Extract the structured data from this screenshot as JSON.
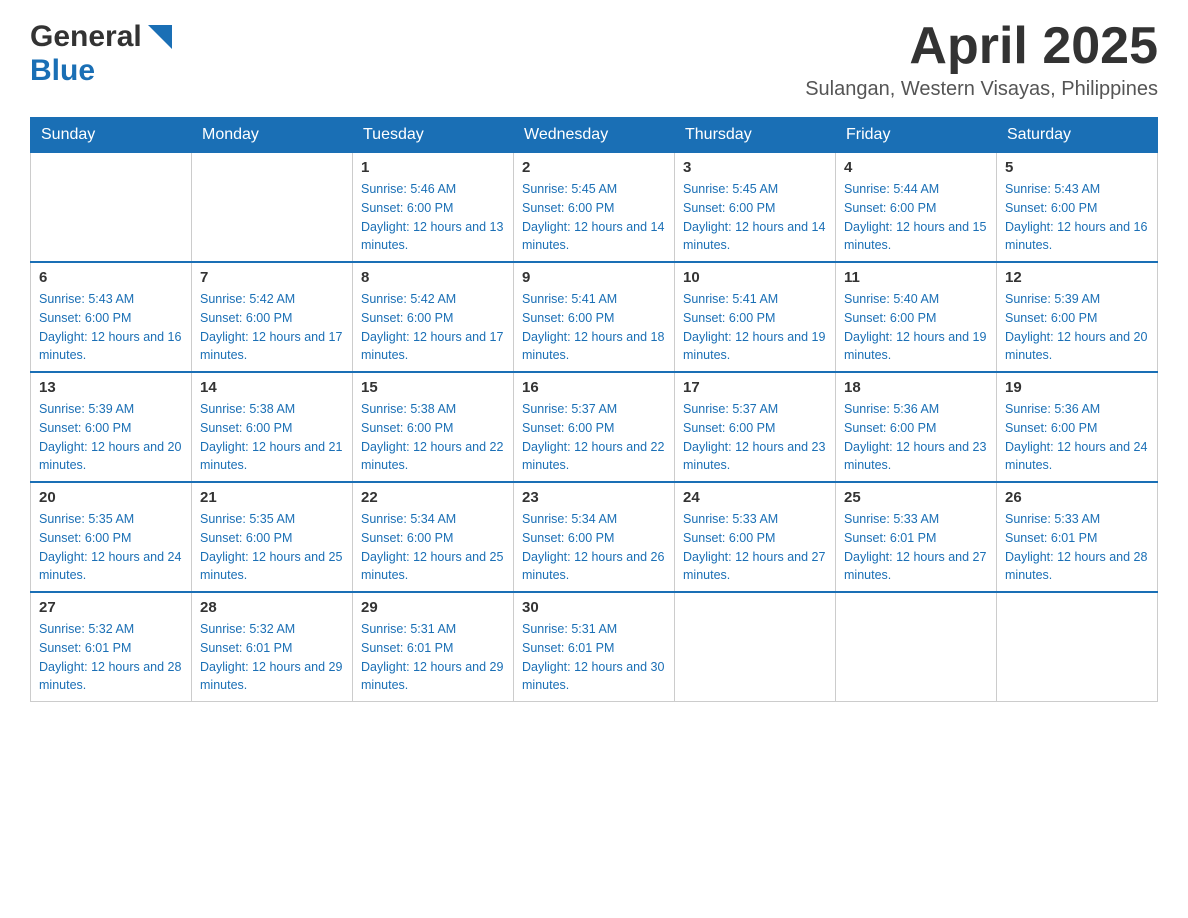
{
  "logo": {
    "general": "General",
    "blue": "Blue"
  },
  "title": {
    "month_year": "April 2025",
    "location": "Sulangan, Western Visayas, Philippines"
  },
  "days_of_week": [
    "Sunday",
    "Monday",
    "Tuesday",
    "Wednesday",
    "Thursday",
    "Friday",
    "Saturday"
  ],
  "weeks": [
    {
      "cells": [
        {
          "day": null
        },
        {
          "day": null
        },
        {
          "day": "1",
          "sunrise": "5:46 AM",
          "sunset": "6:00 PM",
          "daylight": "12 hours and 13 minutes."
        },
        {
          "day": "2",
          "sunrise": "5:45 AM",
          "sunset": "6:00 PM",
          "daylight": "12 hours and 14 minutes."
        },
        {
          "day": "3",
          "sunrise": "5:45 AM",
          "sunset": "6:00 PM",
          "daylight": "12 hours and 14 minutes."
        },
        {
          "day": "4",
          "sunrise": "5:44 AM",
          "sunset": "6:00 PM",
          "daylight": "12 hours and 15 minutes."
        },
        {
          "day": "5",
          "sunrise": "5:43 AM",
          "sunset": "6:00 PM",
          "daylight": "12 hours and 16 minutes."
        }
      ]
    },
    {
      "cells": [
        {
          "day": "6",
          "sunrise": "5:43 AM",
          "sunset": "6:00 PM",
          "daylight": "12 hours and 16 minutes."
        },
        {
          "day": "7",
          "sunrise": "5:42 AM",
          "sunset": "6:00 PM",
          "daylight": "12 hours and 17 minutes."
        },
        {
          "day": "8",
          "sunrise": "5:42 AM",
          "sunset": "6:00 PM",
          "daylight": "12 hours and 17 minutes."
        },
        {
          "day": "9",
          "sunrise": "5:41 AM",
          "sunset": "6:00 PM",
          "daylight": "12 hours and 18 minutes."
        },
        {
          "day": "10",
          "sunrise": "5:41 AM",
          "sunset": "6:00 PM",
          "daylight": "12 hours and 19 minutes."
        },
        {
          "day": "11",
          "sunrise": "5:40 AM",
          "sunset": "6:00 PM",
          "daylight": "12 hours and 19 minutes."
        },
        {
          "day": "12",
          "sunrise": "5:39 AM",
          "sunset": "6:00 PM",
          "daylight": "12 hours and 20 minutes."
        }
      ]
    },
    {
      "cells": [
        {
          "day": "13",
          "sunrise": "5:39 AM",
          "sunset": "6:00 PM",
          "daylight": "12 hours and 20 minutes."
        },
        {
          "day": "14",
          "sunrise": "5:38 AM",
          "sunset": "6:00 PM",
          "daylight": "12 hours and 21 minutes."
        },
        {
          "day": "15",
          "sunrise": "5:38 AM",
          "sunset": "6:00 PM",
          "daylight": "12 hours and 22 minutes."
        },
        {
          "day": "16",
          "sunrise": "5:37 AM",
          "sunset": "6:00 PM",
          "daylight": "12 hours and 22 minutes."
        },
        {
          "day": "17",
          "sunrise": "5:37 AM",
          "sunset": "6:00 PM",
          "daylight": "12 hours and 23 minutes."
        },
        {
          "day": "18",
          "sunrise": "5:36 AM",
          "sunset": "6:00 PM",
          "daylight": "12 hours and 23 minutes."
        },
        {
          "day": "19",
          "sunrise": "5:36 AM",
          "sunset": "6:00 PM",
          "daylight": "12 hours and 24 minutes."
        }
      ]
    },
    {
      "cells": [
        {
          "day": "20",
          "sunrise": "5:35 AM",
          "sunset": "6:00 PM",
          "daylight": "12 hours and 24 minutes."
        },
        {
          "day": "21",
          "sunrise": "5:35 AM",
          "sunset": "6:00 PM",
          "daylight": "12 hours and 25 minutes."
        },
        {
          "day": "22",
          "sunrise": "5:34 AM",
          "sunset": "6:00 PM",
          "daylight": "12 hours and 25 minutes."
        },
        {
          "day": "23",
          "sunrise": "5:34 AM",
          "sunset": "6:00 PM",
          "daylight": "12 hours and 26 minutes."
        },
        {
          "day": "24",
          "sunrise": "5:33 AM",
          "sunset": "6:00 PM",
          "daylight": "12 hours and 27 minutes."
        },
        {
          "day": "25",
          "sunrise": "5:33 AM",
          "sunset": "6:01 PM",
          "daylight": "12 hours and 27 minutes."
        },
        {
          "day": "26",
          "sunrise": "5:33 AM",
          "sunset": "6:01 PM",
          "daylight": "12 hours and 28 minutes."
        }
      ]
    },
    {
      "cells": [
        {
          "day": "27",
          "sunrise": "5:32 AM",
          "sunset": "6:01 PM",
          "daylight": "12 hours and 28 minutes."
        },
        {
          "day": "28",
          "sunrise": "5:32 AM",
          "sunset": "6:01 PM",
          "daylight": "12 hours and 29 minutes."
        },
        {
          "day": "29",
          "sunrise": "5:31 AM",
          "sunset": "6:01 PM",
          "daylight": "12 hours and 29 minutes."
        },
        {
          "day": "30",
          "sunrise": "5:31 AM",
          "sunset": "6:01 PM",
          "daylight": "12 hours and 30 minutes."
        },
        {
          "day": null
        },
        {
          "day": null
        },
        {
          "day": null
        }
      ]
    }
  ],
  "labels": {
    "sunrise_prefix": "Sunrise: ",
    "sunset_prefix": "Sunset: ",
    "daylight_prefix": "Daylight: "
  }
}
